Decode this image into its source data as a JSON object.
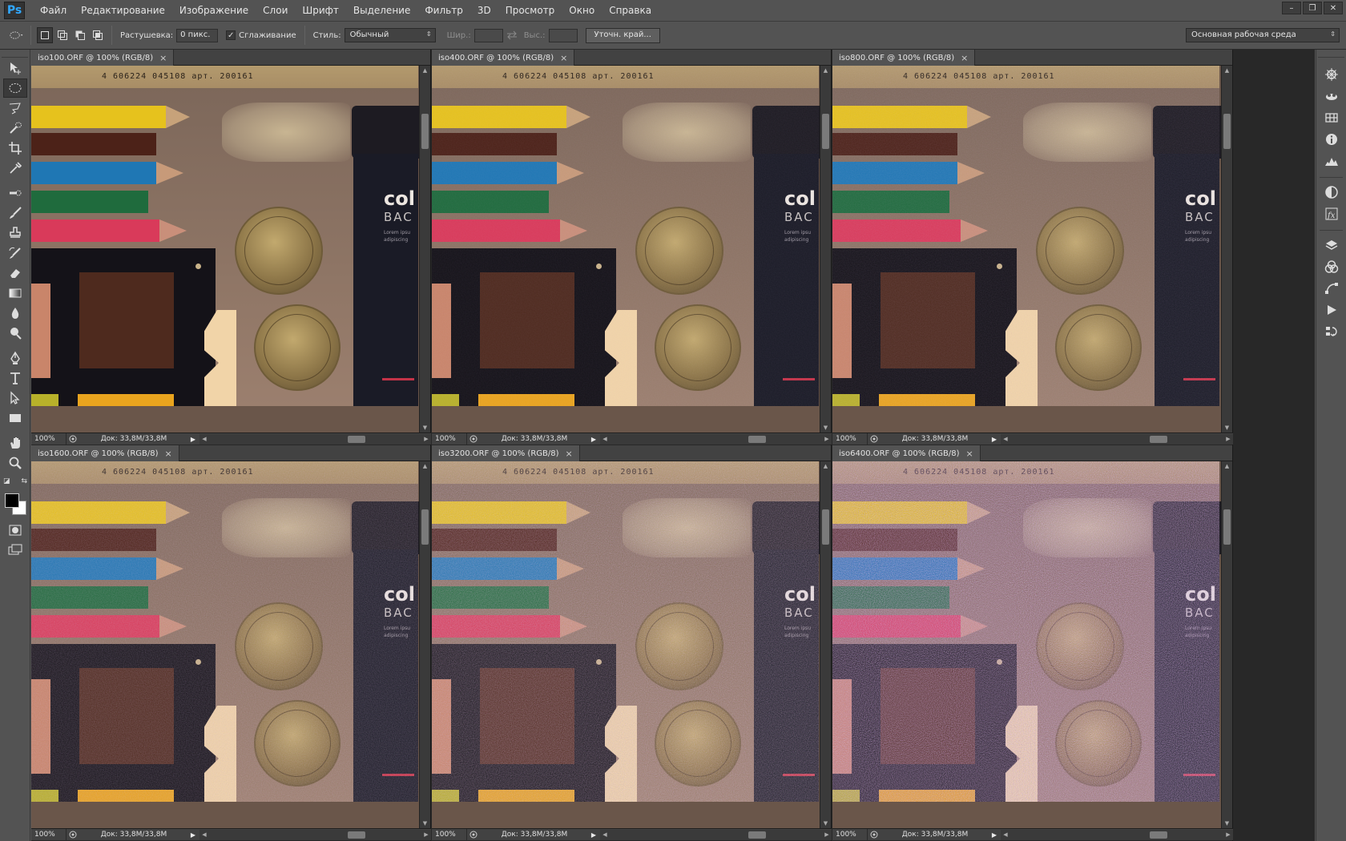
{
  "app": {
    "logo": "Ps"
  },
  "menu": [
    "Файл",
    "Редактирование",
    "Изображение",
    "Слои",
    "Шрифт",
    "Выделение",
    "Фильтр",
    "3D",
    "Просмотр",
    "Окно",
    "Справка"
  ],
  "window_controls": {
    "minimize": "–",
    "restore": "❐",
    "close": "✕"
  },
  "options": {
    "feather_label": "Растушевка:",
    "feather_value": "0 пикс.",
    "antialias_label": "Сглаживание",
    "antialias_checked": true,
    "style_label": "Стиль:",
    "style_value": "Обычный",
    "width_label": "Шир.:",
    "height_label": "Выс.:",
    "refine_button": "Уточн. край...",
    "workspace_value": "Основная рабочая среда"
  },
  "documents": [
    {
      "title": "iso100.ORF @ 100% (RGB/8)",
      "zoom": "100%",
      "doc_info": "Док: 33,8M/33,8M",
      "noise": 0.0
    },
    {
      "title": "iso400.ORF @ 100% (RGB/8)",
      "zoom": "100%",
      "doc_info": "Док: 33,8M/33,8M",
      "noise": 0.08
    },
    {
      "title": "iso800.ORF @ 100% (RGB/8)",
      "zoom": "100%",
      "doc_info": "Док: 33,8M/33,8M",
      "noise": 0.14
    },
    {
      "title": "iso1600.ORF @ 100% (RGB/8)",
      "zoom": "100%",
      "doc_info": "Док: 33,8M/33,8M",
      "noise": 0.28
    },
    {
      "title": "iso3200.ORF @ 100% (RGB/8)",
      "zoom": "100%",
      "doc_info": "Док: 33,8M/33,8M",
      "noise": 0.45
    },
    {
      "title": "iso6400.ORF @ 100% (RGB/8)",
      "zoom": "100%",
      "doc_info": "Док: 33,8M/33,8M",
      "noise": 0.7
    }
  ],
  "image_text": {
    "barcode": "4 606224 045108 арт. 200161",
    "box_title": "col",
    "box_subtitle": "BAC",
    "box_small": "Lorem ipsu\nadipiscing"
  },
  "tools": [
    "move-tool-icon",
    "elliptical-marquee-icon",
    "lasso-icon",
    "quick-selection-icon",
    "crop-icon",
    "eyedropper-icon",
    "spot-healing-icon",
    "brush-icon",
    "clone-stamp-icon",
    "history-brush-icon",
    "eraser-icon",
    "gradient-icon",
    "blur-icon",
    "dodge-icon",
    "pen-icon",
    "type-icon",
    "path-selection-icon",
    "rectangle-icon",
    "hand-icon",
    "zoom-icon"
  ],
  "dock_icons": [
    "navigator-icon",
    "3d-icon",
    "swatches-icon",
    "info-icon",
    "histogram-icon",
    "adjustments-icon",
    "styles-icon",
    "layers-icon",
    "channels-icon",
    "paths-icon",
    "actions-icon",
    "history-icon"
  ]
}
